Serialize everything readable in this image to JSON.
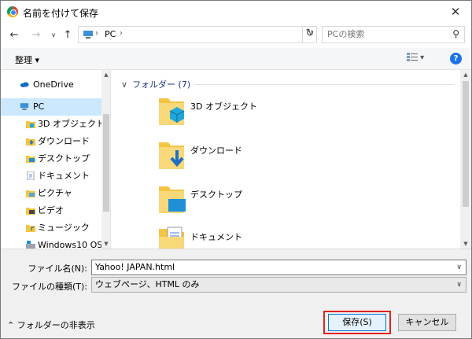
{
  "window": {
    "title": "名前を付けて保存"
  },
  "nav": {
    "breadcrumb": "PC",
    "search_placeholder": "PCの検索"
  },
  "toolbar": {
    "organize_label": "整理 ▾",
    "help": "?"
  },
  "sidebar": {
    "items": [
      {
        "label": "OneDrive",
        "icon": "onedrive-icon"
      },
      {
        "label": "PC",
        "icon": "pc-icon",
        "selected": true
      },
      {
        "label": "3D オブジェクト",
        "icon": "3d-objects-icon"
      },
      {
        "label": "ダウンロード",
        "icon": "downloads-icon"
      },
      {
        "label": "デスクトップ",
        "icon": "desktop-icon"
      },
      {
        "label": "ドキュメント",
        "icon": "documents-icon"
      },
      {
        "label": "ピクチャ",
        "icon": "pictures-icon"
      },
      {
        "label": "ビデオ",
        "icon": "videos-icon"
      },
      {
        "label": "ミュージック",
        "icon": "music-icon"
      },
      {
        "label": "Windows10 OS",
        "icon": "drive-icon"
      }
    ]
  },
  "main": {
    "group_header": "フォルダー (7)",
    "folders": [
      {
        "label": "3D オブジェクト",
        "icon": "3d-objects-folder-icon"
      },
      {
        "label": "ダウンロード",
        "icon": "downloads-folder-icon"
      },
      {
        "label": "デスクトップ",
        "icon": "desktop-folder-icon"
      },
      {
        "label": "ドキュメント",
        "icon": "documents-folder-icon"
      }
    ]
  },
  "form": {
    "filename_label": "ファイル名(N):",
    "filename_value": "Yahoo! JAPAN.html",
    "filetype_label": "ファイルの種類(T):",
    "filetype_value": "ウェブページ、HTML のみ"
  },
  "footer": {
    "hide_folders_label": "フォルダーの非表示",
    "save_label": "保存(S)",
    "cancel_label": "キャンセル"
  },
  "colors": {
    "accent": "#0078d7",
    "highlight": "#e0211d",
    "selected_bg": "#cce8ff",
    "folder": "#f4c542"
  }
}
